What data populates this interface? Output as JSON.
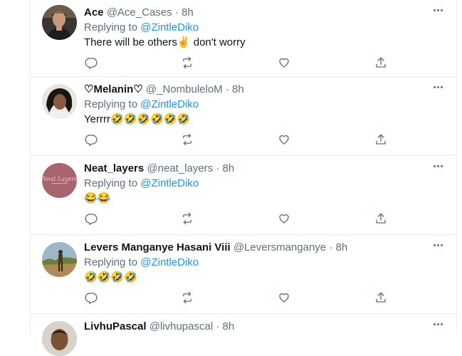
{
  "tweets": [
    {
      "name": "Ace",
      "handle": "@Ace_Cases",
      "dot": "·",
      "time": "8h",
      "replying_prefix": "Replying to ",
      "replying_to": "@ZintleDiko",
      "text": "There will be others✌️ don't worry"
    },
    {
      "name": "♡Melanin♡",
      "handle": "@_NombuleloM",
      "dot": "·",
      "time": "8h",
      "replying_prefix": "Replying to ",
      "replying_to": "@ZintleDiko",
      "text": "Yerrrr🤣🤣🤣🤣🤣🤣"
    },
    {
      "name": "Neat_layers",
      "handle": "@neat_layers",
      "dot": "·",
      "time": "8h",
      "replying_prefix": "Replying to ",
      "replying_to": "@ZintleDiko",
      "text": "😂😂"
    },
    {
      "name": "Levers Manganye Hasani Viii",
      "handle": "@Leversmanganye",
      "dot": "·",
      "time": "8h",
      "replying_prefix": "Replying to ",
      "replying_to": "@ZintleDiko",
      "text": "🤣🤣🤣🤣"
    },
    {
      "name": "LivhuPascal",
      "handle": "@livhupascal",
      "dot": "·",
      "time": "8h",
      "replying_prefix": "",
      "replying_to": "",
      "text": ""
    }
  ],
  "icons": {
    "reply": "reply-icon",
    "retweet": "retweet-icon",
    "like": "heart-icon",
    "share": "share-icon",
    "more": "more-icon"
  },
  "colors": {
    "link": "#1b95e0",
    "muted": "#5b7083",
    "text": "#0f1419",
    "border": "#ebeef0"
  }
}
